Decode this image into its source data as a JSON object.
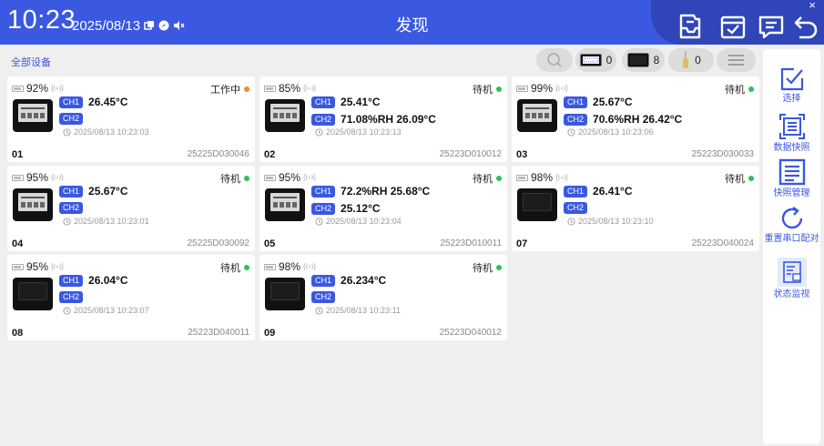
{
  "header": {
    "time": "10:23",
    "date": "2025/08/13",
    "title": "发现",
    "close": "×"
  },
  "toolbar": {
    "all_devices": "全部设备",
    "count_type1": "0",
    "count_type2": "8",
    "count_type3": "0"
  },
  "side": [
    {
      "label": "选择"
    },
    {
      "label": "数据快照"
    },
    {
      "label": "快照管理"
    },
    {
      "label": "重置串口配对"
    },
    {
      "label": "状态监视"
    }
  ],
  "cards": [
    {
      "id": "01",
      "serial": "25225D030046",
      "battery": "92%",
      "status": "工作中",
      "status_color": "#f5891e",
      "ch1": "26.45°C",
      "ch2": "",
      "time": "2025/08/13 10:23:03",
      "screen": "light"
    },
    {
      "id": "02",
      "serial": "25223D010012",
      "battery": "85%",
      "status": "待机",
      "status_color": "#2bc35a",
      "ch1": "25.41°C",
      "ch2": "71.08%RH 26.09°C",
      "time": "2025/08/13 10:23:13",
      "screen": "light"
    },
    {
      "id": "03",
      "serial": "25223D030033",
      "battery": "99%",
      "status": "待机",
      "status_color": "#2bc35a",
      "ch1": "25.67°C",
      "ch2": "70.6%RH 26.42°C",
      "time": "2025/08/13 10:23:06",
      "screen": "light"
    },
    {
      "id": "04",
      "serial": "25225D030092",
      "battery": "95%",
      "status": "待机",
      "status_color": "#2bc35a",
      "ch1": "25.67°C",
      "ch2": "",
      "time": "2025/08/13 10:23:01",
      "screen": "light"
    },
    {
      "id": "05",
      "serial": "25223D010011",
      "battery": "95%",
      "status": "待机",
      "status_color": "#2bc35a",
      "ch1": "72.2%RH 25.68°C",
      "ch2": "25.12°C",
      "time": "2025/08/13 10:23:04",
      "screen": "light"
    },
    {
      "id": "07",
      "serial": "25223D040024",
      "battery": "98%",
      "status": "待机",
      "status_color": "#2bc35a",
      "ch1": "26.41°C",
      "ch2": "",
      "time": "2025/08/13 10:23:10",
      "screen": "dark"
    },
    {
      "id": "08",
      "serial": "25223D040011",
      "battery": "95%",
      "status": "待机",
      "status_color": "#2bc35a",
      "ch1": "26.04°C",
      "ch2": "",
      "time": "2025/08/13 10:23:07",
      "screen": "dark"
    },
    {
      "id": "09",
      "serial": "25223D040012",
      "battery": "98%",
      "status": "待机",
      "status_color": "#2bc35a",
      "ch1": "26.234°C",
      "ch2": "",
      "time": "2025/08/13 10:23:11",
      "screen": "dark"
    }
  ],
  "colors": {
    "accent": "#3a58e0",
    "working": "#f5891e",
    "standby": "#2bc35a"
  }
}
